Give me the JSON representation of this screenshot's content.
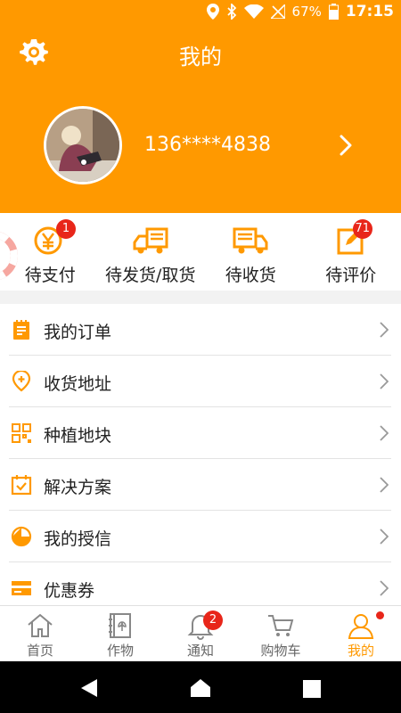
{
  "status": {
    "battery": "67%",
    "time": "17:15"
  },
  "header": {
    "title": "我的",
    "phone": "136****4838"
  },
  "orders": [
    {
      "label": "待支付",
      "badge": "1"
    },
    {
      "label": "待发货/取货",
      "badge": ""
    },
    {
      "label": "待收货",
      "badge": ""
    },
    {
      "label": "待评价",
      "badge": "71"
    }
  ],
  "menu": [
    {
      "label": "我的订单"
    },
    {
      "label": "收货地址"
    },
    {
      "label": "种植地块"
    },
    {
      "label": "解决方案"
    },
    {
      "label": "我的授信"
    },
    {
      "label": "优惠券"
    }
  ],
  "tabs": [
    {
      "label": "首页"
    },
    {
      "label": "作物"
    },
    {
      "label": "通知",
      "badge": "2"
    },
    {
      "label": "购物车"
    },
    {
      "label": "我的"
    }
  ],
  "colors": {
    "accent": "#ff9900",
    "badge": "#e8261a"
  }
}
